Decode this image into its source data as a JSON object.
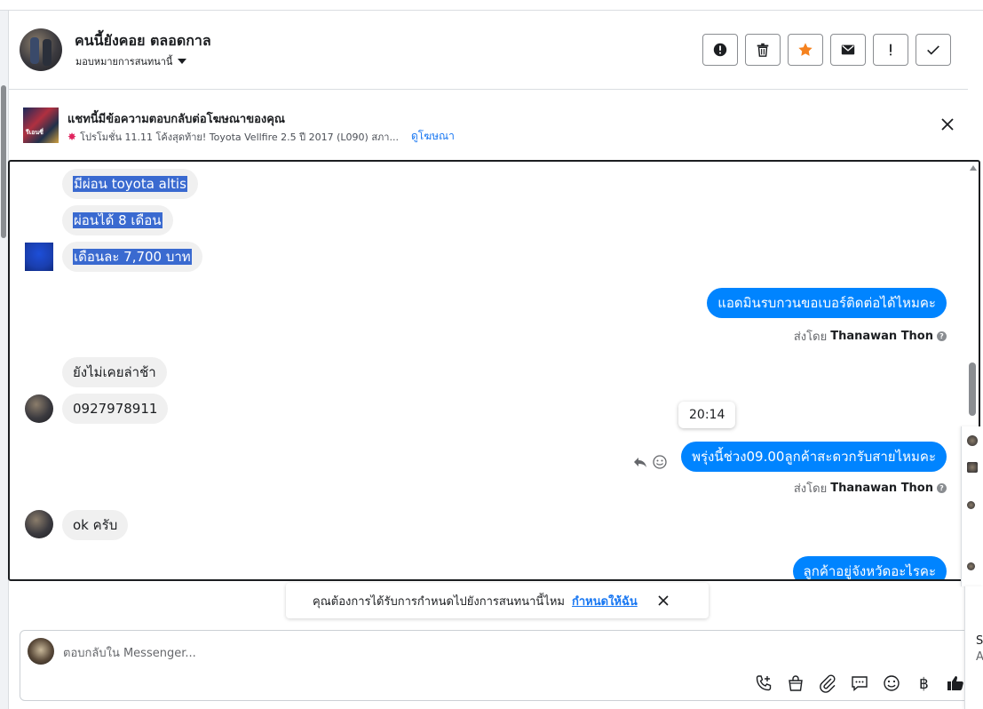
{
  "header": {
    "name": "คนนี้ยังคอย ตลอดกาล",
    "assign_label": "มอบหมายการสนทนานี้",
    "actions": [
      "report-spam",
      "delete",
      "star",
      "mark-unread",
      "follow-up",
      "done"
    ]
  },
  "ad_banner": {
    "title": "แชทนี้มีข้อความตอบกลับต่อโฆษณาของคุณ",
    "thumb_text": "รีเอนซี่",
    "subtitle": "โปรโมชั่น 11.11 โค้งสุดท้าย! Toyota Vellfire 2.5 ปี 2017 (L090) สภา...",
    "link": "ดูโฆษณา"
  },
  "messages": {
    "m1": "มีผ่อน toyota altis",
    "m2": "ผ่อนได้ 8 เดือน",
    "m3": "เดือนละ 7,700 บาท",
    "m4": "แอดมินรบกวนขอเบอร์ติดต่อได้ไหมคะ",
    "m5": "ยังไม่เคยล่าช้า",
    "m6": "0927978911",
    "m7": "พรุ่งนี้ช่วง09.00ลูกค้าสะดวกรับสายไหมคะ",
    "m8": "ok ครับ",
    "m9": "ลูกค้าอยู่จังหวัดอะไรคะ",
    "tooltip_time": "20:14",
    "sent_by_prefix": "ส่งโดย",
    "sent_by_name": "Thanawan Thon",
    "help_mark": "?"
  },
  "assign_toast": {
    "text": "คุณต้องการได้รับการกำหนดไปยังการสนทนานี้ไหม",
    "link": "กำหนดให้ฉัน"
  },
  "composer": {
    "placeholder": "ตอบกลับใน Messenger...",
    "tools": [
      "call-icon",
      "shop-bag-icon",
      "attach-icon",
      "saved-reply-icon",
      "emoji-icon",
      "currency-icon",
      "like-icon"
    ],
    "currency_glyph": "฿"
  },
  "edge": {
    "card_letter_top": "S",
    "card_letter_bottom": "A"
  }
}
